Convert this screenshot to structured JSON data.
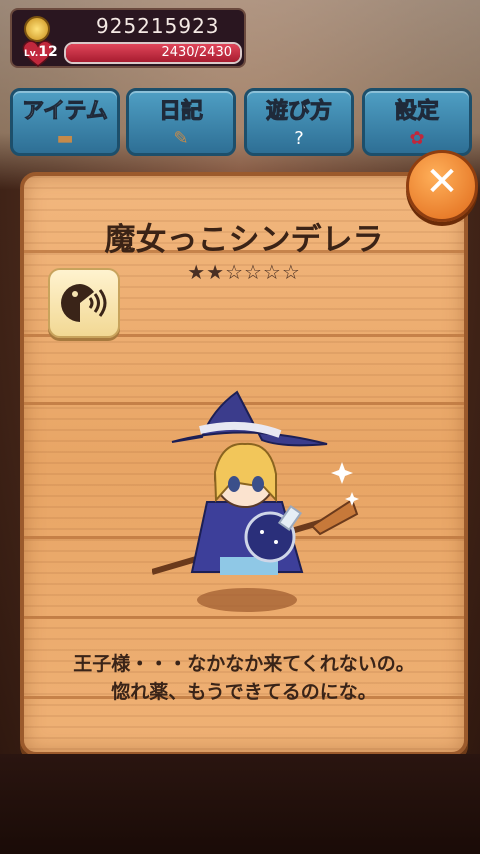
{
  "hud": {
    "coins": "925215923",
    "level_prefix": "Lv.",
    "level": "12",
    "hp_text": "2430/2430",
    "hp_fraction": 1.0
  },
  "tabs": [
    {
      "label": "アイテム",
      "icon": "basket-icon"
    },
    {
      "label": "日記",
      "icon": "book-quill-icon"
    },
    {
      "label": "遊び方",
      "icon": "question-icon"
    },
    {
      "label": "設定",
      "icon": "rose-icon"
    }
  ],
  "card": {
    "title": "魔女っこシンデレラ",
    "rating_max": 6,
    "rating": 2,
    "stars_text": "★★☆☆☆☆",
    "description_line1": "王子様・・・なかなか来てくれないの。",
    "description_line2": "惚れ薬、もうできてるのにな。"
  },
  "close_label": "✕",
  "colors": {
    "panel": "#e8a565",
    "tab": "#3f8bb3",
    "close": "#e87a28",
    "hp": "#c0283c"
  }
}
